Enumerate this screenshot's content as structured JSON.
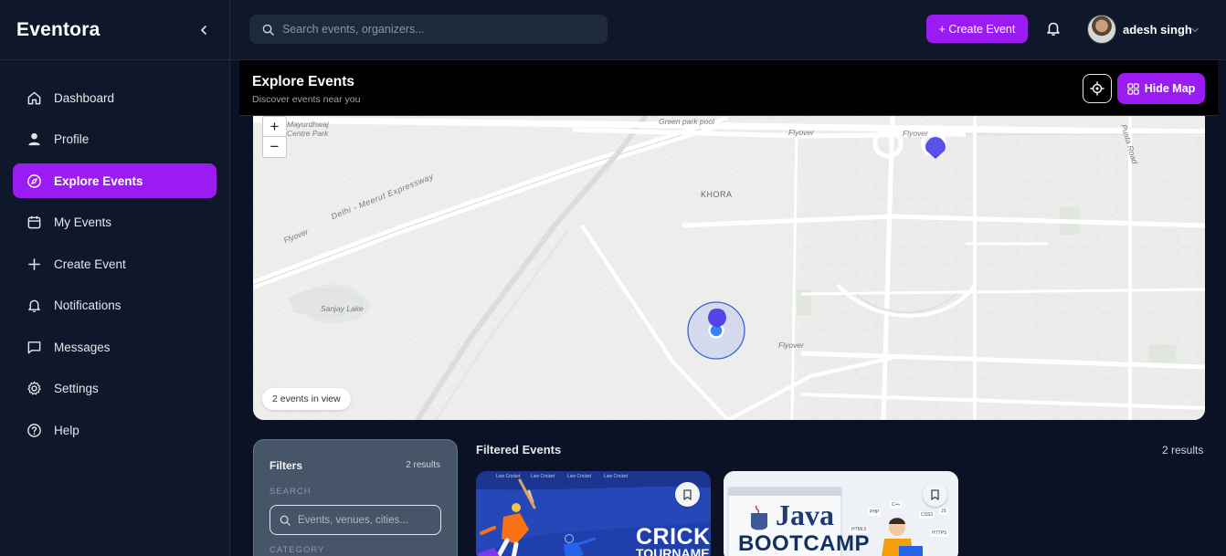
{
  "app": {
    "brand": "Eventora"
  },
  "sidebar": {
    "items": [
      {
        "label": "Dashboard",
        "icon": "home-icon",
        "active": false
      },
      {
        "label": "Profile",
        "icon": "user-icon",
        "active": false
      },
      {
        "label": "Explore Events",
        "icon": "compass-icon",
        "active": true
      },
      {
        "label": "My Events",
        "icon": "calendar-icon",
        "active": false
      },
      {
        "label": "Create Event",
        "icon": "plus-icon",
        "active": false
      },
      {
        "label": "Notifications",
        "icon": "bell-icon",
        "active": false
      },
      {
        "label": "Messages",
        "icon": "message-icon",
        "active": false
      },
      {
        "label": "Settings",
        "icon": "gear-icon",
        "active": false
      },
      {
        "label": "Help",
        "icon": "help-circle-icon",
        "active": false
      }
    ]
  },
  "topbar": {
    "search_placeholder": "Search events, organizers...",
    "create_label": "+ Create Event",
    "user_name": "adesh singh"
  },
  "explore": {
    "title": "Explore Events",
    "subtitle": "Discover events near you",
    "hide_map_label": "Hide Map"
  },
  "map": {
    "labels": {
      "mayur": "Mayurdhwaj",
      "mayur2": "Centre Park",
      "green_park": "Green park pool",
      "flyover1": "Flyover",
      "flyover2": "Flyover",
      "flyover3": "Flyover",
      "flyover4": "Flyover",
      "khora": "KHORA",
      "expressway": "Delhi - Meerut Expressway",
      "sanjay": "Sanjay Lake",
      "road": "Pusta Road"
    },
    "events_in_view": "2 events in view",
    "zoom_in": "+",
    "zoom_out": "−"
  },
  "filters": {
    "title": "Filters",
    "results": "2 results",
    "search_section": "SEARCH",
    "search_placeholder": "Events, venues, cities...",
    "category_section": "CATEGORY"
  },
  "events": {
    "title": "Filtered Events",
    "results": "2 results",
    "cards": [
      {
        "headline": "CRICKE",
        "subline": "TOURNAME",
        "small_text": "Live Cricket"
      },
      {
        "headline": "Java",
        "subline": "BOOTCAMP",
        "tags": [
          "PHP",
          "C++",
          "HTML5",
          "CSS3",
          "HTTPS",
          "JS"
        ]
      }
    ]
  },
  "colors": {
    "accent": "#9b1cf2",
    "sidebar_bg": "#0f172a",
    "map_pin": "#5b4de6"
  }
}
